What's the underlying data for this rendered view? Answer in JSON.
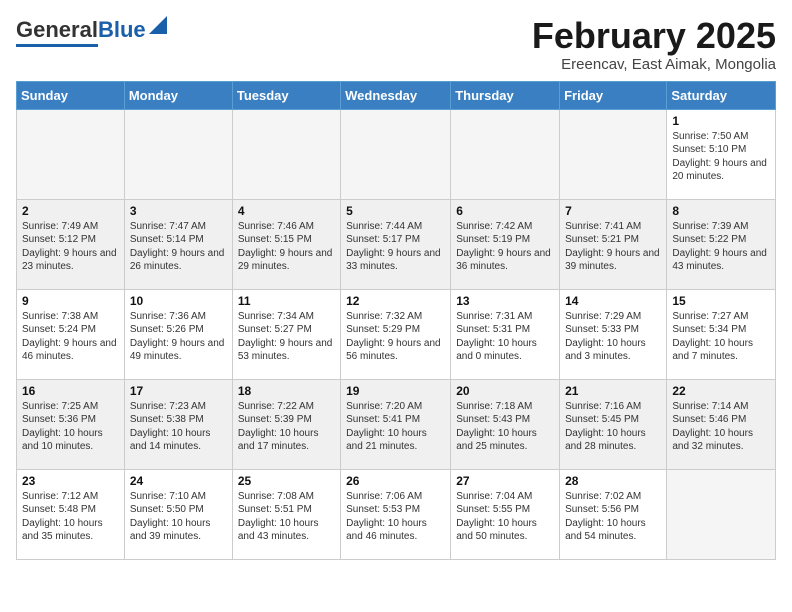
{
  "header": {
    "logo_general": "General",
    "logo_blue": "Blue",
    "title": "February 2025",
    "subtitle": "Ereencav, East Aimak, Mongolia"
  },
  "weekdays": [
    "Sunday",
    "Monday",
    "Tuesday",
    "Wednesday",
    "Thursday",
    "Friday",
    "Saturday"
  ],
  "weeks": [
    [
      {
        "day": "",
        "info": "",
        "empty": true
      },
      {
        "day": "",
        "info": "",
        "empty": true
      },
      {
        "day": "",
        "info": "",
        "empty": true
      },
      {
        "day": "",
        "info": "",
        "empty": true
      },
      {
        "day": "",
        "info": "",
        "empty": true
      },
      {
        "day": "",
        "info": "",
        "empty": true
      },
      {
        "day": "1",
        "info": "Sunrise: 7:50 AM\nSunset: 5:10 PM\nDaylight: 9 hours and 20 minutes."
      }
    ],
    [
      {
        "day": "2",
        "info": "Sunrise: 7:49 AM\nSunset: 5:12 PM\nDaylight: 9 hours and 23 minutes."
      },
      {
        "day": "3",
        "info": "Sunrise: 7:47 AM\nSunset: 5:14 PM\nDaylight: 9 hours and 26 minutes."
      },
      {
        "day": "4",
        "info": "Sunrise: 7:46 AM\nSunset: 5:15 PM\nDaylight: 9 hours and 29 minutes."
      },
      {
        "day": "5",
        "info": "Sunrise: 7:44 AM\nSunset: 5:17 PM\nDaylight: 9 hours and 33 minutes."
      },
      {
        "day": "6",
        "info": "Sunrise: 7:42 AM\nSunset: 5:19 PM\nDaylight: 9 hours and 36 minutes."
      },
      {
        "day": "7",
        "info": "Sunrise: 7:41 AM\nSunset: 5:21 PM\nDaylight: 9 hours and 39 minutes."
      },
      {
        "day": "8",
        "info": "Sunrise: 7:39 AM\nSunset: 5:22 PM\nDaylight: 9 hours and 43 minutes."
      }
    ],
    [
      {
        "day": "9",
        "info": "Sunrise: 7:38 AM\nSunset: 5:24 PM\nDaylight: 9 hours and 46 minutes."
      },
      {
        "day": "10",
        "info": "Sunrise: 7:36 AM\nSunset: 5:26 PM\nDaylight: 9 hours and 49 minutes."
      },
      {
        "day": "11",
        "info": "Sunrise: 7:34 AM\nSunset: 5:27 PM\nDaylight: 9 hours and 53 minutes."
      },
      {
        "day": "12",
        "info": "Sunrise: 7:32 AM\nSunset: 5:29 PM\nDaylight: 9 hours and 56 minutes."
      },
      {
        "day": "13",
        "info": "Sunrise: 7:31 AM\nSunset: 5:31 PM\nDaylight: 10 hours and 0 minutes."
      },
      {
        "day": "14",
        "info": "Sunrise: 7:29 AM\nSunset: 5:33 PM\nDaylight: 10 hours and 3 minutes."
      },
      {
        "day": "15",
        "info": "Sunrise: 7:27 AM\nSunset: 5:34 PM\nDaylight: 10 hours and 7 minutes."
      }
    ],
    [
      {
        "day": "16",
        "info": "Sunrise: 7:25 AM\nSunset: 5:36 PM\nDaylight: 10 hours and 10 minutes."
      },
      {
        "day": "17",
        "info": "Sunrise: 7:23 AM\nSunset: 5:38 PM\nDaylight: 10 hours and 14 minutes."
      },
      {
        "day": "18",
        "info": "Sunrise: 7:22 AM\nSunset: 5:39 PM\nDaylight: 10 hours and 17 minutes."
      },
      {
        "day": "19",
        "info": "Sunrise: 7:20 AM\nSunset: 5:41 PM\nDaylight: 10 hours and 21 minutes."
      },
      {
        "day": "20",
        "info": "Sunrise: 7:18 AM\nSunset: 5:43 PM\nDaylight: 10 hours and 25 minutes."
      },
      {
        "day": "21",
        "info": "Sunrise: 7:16 AM\nSunset: 5:45 PM\nDaylight: 10 hours and 28 minutes."
      },
      {
        "day": "22",
        "info": "Sunrise: 7:14 AM\nSunset: 5:46 PM\nDaylight: 10 hours and 32 minutes."
      }
    ],
    [
      {
        "day": "23",
        "info": "Sunrise: 7:12 AM\nSunset: 5:48 PM\nDaylight: 10 hours and 35 minutes."
      },
      {
        "day": "24",
        "info": "Sunrise: 7:10 AM\nSunset: 5:50 PM\nDaylight: 10 hours and 39 minutes."
      },
      {
        "day": "25",
        "info": "Sunrise: 7:08 AM\nSunset: 5:51 PM\nDaylight: 10 hours and 43 minutes."
      },
      {
        "day": "26",
        "info": "Sunrise: 7:06 AM\nSunset: 5:53 PM\nDaylight: 10 hours and 46 minutes."
      },
      {
        "day": "27",
        "info": "Sunrise: 7:04 AM\nSunset: 5:55 PM\nDaylight: 10 hours and 50 minutes."
      },
      {
        "day": "28",
        "info": "Sunrise: 7:02 AM\nSunset: 5:56 PM\nDaylight: 10 hours and 54 minutes."
      },
      {
        "day": "",
        "info": "",
        "empty": true
      }
    ]
  ]
}
